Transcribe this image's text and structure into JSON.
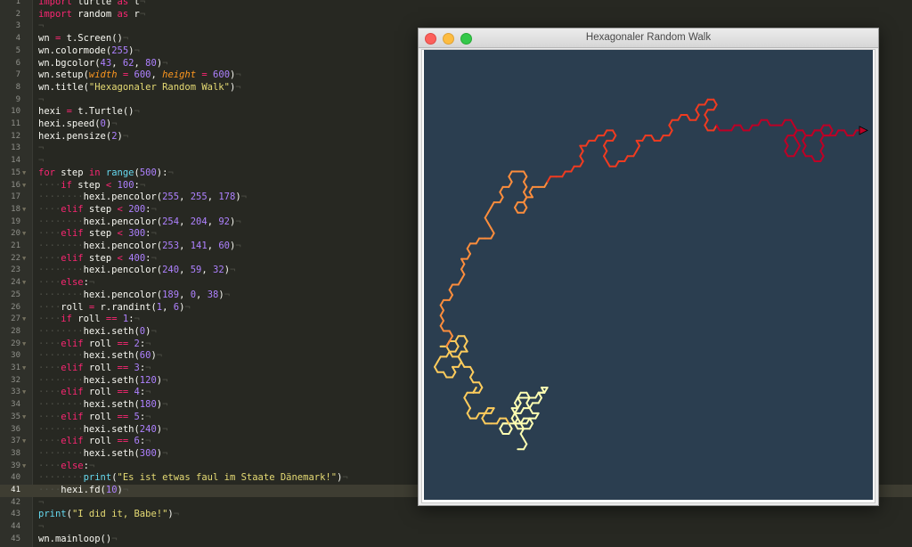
{
  "editor": {
    "active_line": 41,
    "lines": [
      {
        "n": 1,
        "t": [
          [
            "kw",
            "import"
          ],
          [
            "p",
            " turtle "
          ],
          [
            "kw",
            "as"
          ],
          [
            "p",
            " t"
          ]
        ]
      },
      {
        "n": 2,
        "t": [
          [
            "kw",
            "import"
          ],
          [
            "p",
            " random "
          ],
          [
            "kw",
            "as"
          ],
          [
            "p",
            " r"
          ]
        ]
      },
      {
        "n": 3,
        "t": []
      },
      {
        "n": 4,
        "t": [
          [
            "p",
            "wn "
          ],
          [
            "kw",
            "="
          ],
          [
            "p",
            " t.Screen()"
          ]
        ]
      },
      {
        "n": 5,
        "t": [
          [
            "p",
            "wn.colormode("
          ],
          [
            "num",
            "255"
          ],
          [
            "p",
            ")"
          ]
        ]
      },
      {
        "n": 6,
        "t": [
          [
            "p",
            "wn.bgcolor("
          ],
          [
            "num",
            "43"
          ],
          [
            "p",
            ", "
          ],
          [
            "num",
            "62"
          ],
          [
            "p",
            ", "
          ],
          [
            "num",
            "80"
          ],
          [
            "p",
            ")"
          ]
        ]
      },
      {
        "n": 7,
        "t": [
          [
            "p",
            "wn.setup("
          ],
          [
            "arg",
            "width"
          ],
          [
            "p",
            " "
          ],
          [
            "kw",
            "="
          ],
          [
            "p",
            " "
          ],
          [
            "num",
            "600"
          ],
          [
            "p",
            ", "
          ],
          [
            "arg",
            "height"
          ],
          [
            "p",
            " "
          ],
          [
            "kw",
            "="
          ],
          [
            "p",
            " "
          ],
          [
            "num",
            "600"
          ],
          [
            "p",
            ")"
          ]
        ]
      },
      {
        "n": 8,
        "t": [
          [
            "p",
            "wn.title("
          ],
          [
            "str",
            "\"Hexagonaler Random Walk\""
          ],
          [
            "p",
            ")"
          ]
        ]
      },
      {
        "n": 9,
        "t": []
      },
      {
        "n": 10,
        "t": [
          [
            "p",
            "hexi "
          ],
          [
            "kw",
            "="
          ],
          [
            "p",
            " t.Turtle()"
          ]
        ]
      },
      {
        "n": 11,
        "t": [
          [
            "p",
            "hexi.speed("
          ],
          [
            "num",
            "0"
          ],
          [
            "p",
            ")"
          ]
        ]
      },
      {
        "n": 12,
        "t": [
          [
            "p",
            "hexi.pensize("
          ],
          [
            "num",
            "2"
          ],
          [
            "p",
            ")"
          ]
        ]
      },
      {
        "n": 13,
        "t": []
      },
      {
        "n": 14,
        "t": []
      },
      {
        "n": 15,
        "fold": true,
        "t": [
          [
            "kw",
            "for"
          ],
          [
            "p",
            " step "
          ],
          [
            "kw",
            "in"
          ],
          [
            "p",
            " "
          ],
          [
            "fn",
            "range"
          ],
          [
            "p",
            "("
          ],
          [
            "num",
            "500"
          ],
          [
            "p",
            "):"
          ]
        ]
      },
      {
        "n": 16,
        "fold": true,
        "indent": 1,
        "t": [
          [
            "kw",
            "if"
          ],
          [
            "p",
            " step "
          ],
          [
            "kw",
            "<"
          ],
          [
            "p",
            " "
          ],
          [
            "num",
            "100"
          ],
          [
            "p",
            ":"
          ]
        ]
      },
      {
        "n": 17,
        "indent": 2,
        "t": [
          [
            "p",
            "hexi.pencolor("
          ],
          [
            "num",
            "255"
          ],
          [
            "p",
            ", "
          ],
          [
            "num",
            "255"
          ],
          [
            "p",
            ", "
          ],
          [
            "num",
            "178"
          ],
          [
            "p",
            ")"
          ]
        ]
      },
      {
        "n": 18,
        "fold": true,
        "indent": 1,
        "t": [
          [
            "kw",
            "elif"
          ],
          [
            "p",
            " step "
          ],
          [
            "kw",
            "<"
          ],
          [
            "p",
            " "
          ],
          [
            "num",
            "200"
          ],
          [
            "p",
            ":"
          ]
        ]
      },
      {
        "n": 19,
        "indent": 2,
        "t": [
          [
            "p",
            "hexi.pencolor("
          ],
          [
            "num",
            "254"
          ],
          [
            "p",
            ", "
          ],
          [
            "num",
            "204"
          ],
          [
            "p",
            ", "
          ],
          [
            "num",
            "92"
          ],
          [
            "p",
            ")"
          ]
        ]
      },
      {
        "n": 20,
        "fold": true,
        "indent": 1,
        "t": [
          [
            "kw",
            "elif"
          ],
          [
            "p",
            " step "
          ],
          [
            "kw",
            "<"
          ],
          [
            "p",
            " "
          ],
          [
            "num",
            "300"
          ],
          [
            "p",
            ":"
          ]
        ]
      },
      {
        "n": 21,
        "indent": 2,
        "t": [
          [
            "p",
            "hexi.pencolor("
          ],
          [
            "num",
            "253"
          ],
          [
            "p",
            ", "
          ],
          [
            "num",
            "141"
          ],
          [
            "p",
            ", "
          ],
          [
            "num",
            "60"
          ],
          [
            "p",
            ")"
          ]
        ]
      },
      {
        "n": 22,
        "fold": true,
        "indent": 1,
        "t": [
          [
            "kw",
            "elif"
          ],
          [
            "p",
            " step "
          ],
          [
            "kw",
            "<"
          ],
          [
            "p",
            " "
          ],
          [
            "num",
            "400"
          ],
          [
            "p",
            ":"
          ]
        ]
      },
      {
        "n": 23,
        "indent": 2,
        "t": [
          [
            "p",
            "hexi.pencolor("
          ],
          [
            "num",
            "240"
          ],
          [
            "p",
            ", "
          ],
          [
            "num",
            "59"
          ],
          [
            "p",
            ", "
          ],
          [
            "num",
            "32"
          ],
          [
            "p",
            ")"
          ]
        ]
      },
      {
        "n": 24,
        "fold": true,
        "indent": 1,
        "t": [
          [
            "kw",
            "else"
          ],
          [
            "p",
            ":"
          ]
        ]
      },
      {
        "n": 25,
        "indent": 2,
        "t": [
          [
            "p",
            "hexi.pencolor("
          ],
          [
            "num",
            "189"
          ],
          [
            "p",
            ", "
          ],
          [
            "num",
            "0"
          ],
          [
            "p",
            ", "
          ],
          [
            "num",
            "38"
          ],
          [
            "p",
            ")"
          ]
        ]
      },
      {
        "n": 26,
        "indent": 1,
        "t": [
          [
            "p",
            "roll "
          ],
          [
            "kw",
            "="
          ],
          [
            "p",
            " r.randint("
          ],
          [
            "num",
            "1"
          ],
          [
            "p",
            ", "
          ],
          [
            "num",
            "6"
          ],
          [
            "p",
            ")"
          ]
        ]
      },
      {
        "n": 27,
        "fold": true,
        "indent": 1,
        "t": [
          [
            "kw",
            "if"
          ],
          [
            "p",
            " roll "
          ],
          [
            "kw",
            "=="
          ],
          [
            "p",
            " "
          ],
          [
            "num",
            "1"
          ],
          [
            "p",
            ":"
          ]
        ]
      },
      {
        "n": 28,
        "indent": 2,
        "t": [
          [
            "p",
            "hexi.seth("
          ],
          [
            "num",
            "0"
          ],
          [
            "p",
            ")"
          ]
        ]
      },
      {
        "n": 29,
        "fold": true,
        "indent": 1,
        "t": [
          [
            "kw",
            "elif"
          ],
          [
            "p",
            " roll "
          ],
          [
            "kw",
            "=="
          ],
          [
            "p",
            " "
          ],
          [
            "num",
            "2"
          ],
          [
            "p",
            ":"
          ]
        ]
      },
      {
        "n": 30,
        "indent": 2,
        "t": [
          [
            "p",
            "hexi.seth("
          ],
          [
            "num",
            "60"
          ],
          [
            "p",
            ")"
          ]
        ]
      },
      {
        "n": 31,
        "fold": true,
        "indent": 1,
        "t": [
          [
            "kw",
            "elif"
          ],
          [
            "p",
            " roll "
          ],
          [
            "kw",
            "=="
          ],
          [
            "p",
            " "
          ],
          [
            "num",
            "3"
          ],
          [
            "p",
            ":"
          ]
        ]
      },
      {
        "n": 32,
        "indent": 2,
        "t": [
          [
            "p",
            "hexi.seth("
          ],
          [
            "num",
            "120"
          ],
          [
            "p",
            ")"
          ]
        ]
      },
      {
        "n": 33,
        "fold": true,
        "indent": 1,
        "t": [
          [
            "kw",
            "elif"
          ],
          [
            "p",
            " roll "
          ],
          [
            "kw",
            "=="
          ],
          [
            "p",
            " "
          ],
          [
            "num",
            "4"
          ],
          [
            "p",
            ":"
          ]
        ]
      },
      {
        "n": 34,
        "indent": 2,
        "t": [
          [
            "p",
            "hexi.seth("
          ],
          [
            "num",
            "180"
          ],
          [
            "p",
            ")"
          ]
        ]
      },
      {
        "n": 35,
        "fold": true,
        "indent": 1,
        "t": [
          [
            "kw",
            "elif"
          ],
          [
            "p",
            " roll "
          ],
          [
            "kw",
            "=="
          ],
          [
            "p",
            " "
          ],
          [
            "num",
            "5"
          ],
          [
            "p",
            ":"
          ]
        ]
      },
      {
        "n": 36,
        "indent": 2,
        "t": [
          [
            "p",
            "hexi.seth("
          ],
          [
            "num",
            "240"
          ],
          [
            "p",
            ")"
          ]
        ]
      },
      {
        "n": 37,
        "fold": true,
        "indent": 1,
        "t": [
          [
            "kw",
            "elif"
          ],
          [
            "p",
            " roll "
          ],
          [
            "kw",
            "=="
          ],
          [
            "p",
            " "
          ],
          [
            "num",
            "6"
          ],
          [
            "p",
            ":"
          ]
        ]
      },
      {
        "n": 38,
        "indent": 2,
        "t": [
          [
            "p",
            "hexi.seth("
          ],
          [
            "num",
            "300"
          ],
          [
            "p",
            ")"
          ]
        ]
      },
      {
        "n": 39,
        "fold": true,
        "indent": 1,
        "t": [
          [
            "kw",
            "else"
          ],
          [
            "p",
            ":"
          ]
        ]
      },
      {
        "n": 40,
        "indent": 2,
        "t": [
          [
            "fn",
            "print"
          ],
          [
            "p",
            "("
          ],
          [
            "str",
            "\"Es ist etwas faul im Staate Dänemark!\""
          ],
          [
            "p",
            ")"
          ]
        ]
      },
      {
        "n": 41,
        "indent": 1,
        "t": [
          [
            "p",
            "hexi.fd("
          ],
          [
            "num",
            "10"
          ],
          [
            "p",
            ")"
          ]
        ]
      },
      {
        "n": 42,
        "t": []
      },
      {
        "n": 43,
        "t": [
          [
            "fn",
            "print"
          ],
          [
            "p",
            "("
          ],
          [
            "str",
            "\"I did it, Babe!\""
          ],
          [
            "p",
            ")"
          ]
        ]
      },
      {
        "n": 44,
        "t": []
      },
      {
        "n": 45,
        "t": [
          [
            "p",
            "wn.mainloop()"
          ]
        ]
      }
    ]
  },
  "turtle_window": {
    "title": "Hexagonaler Random Walk",
    "bgcolor": "#2b3e50",
    "walk": {
      "start_heading": 0,
      "cursor_color": "#bd0026",
      "phases": [
        {
          "color": "#ffffb2",
          "dirs": "1233234121654433212161545433232111213154654532345654665441654321"
        },
        {
          "color": "#fecc5c",
          "dirs": "3454432124545432332125123432343343321216564565465434322121234541"
        },
        {
          "color": "#fd8d3c",
          "dirs": "2234323232123212232312321211233322212321232116565656543212132112"
        },
        {
          "color": "#f03b20",
          "dirs": "2112121232312121216545656612121223121612123212161232121654565612"
        },
        {
          "color": "#bd0026",
          "dirs": "6112161212161121665456561223321612121654565654343232121611216121"
        }
      ]
    }
  }
}
